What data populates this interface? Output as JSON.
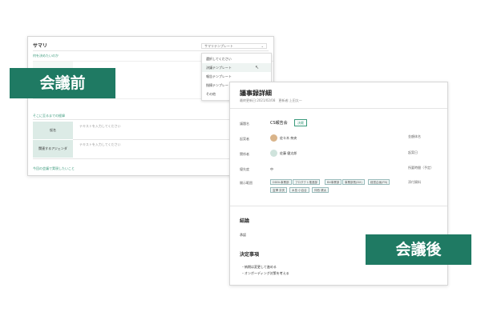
{
  "before": {
    "banner": "会議前",
    "title": "サマリ",
    "template_select": "サマリテンプレート",
    "question1": "何を決めたいのか",
    "dropdown_items": [
      "選択してください",
      "決議テンプレート",
      "報告テンプレート",
      "指摘テンプレート",
      "その他"
    ],
    "section2": "そこに至るまでの経緯",
    "row1_label": "仮名",
    "row2_label": "関連するアジェンダ",
    "placeholder": "テキストを入力してください",
    "question3": "今回の会議で実現したいこと"
  },
  "after": {
    "banner": "会議後",
    "title": "議事録詳細",
    "subtitle": "最終更新日:2021/02/08　更新者:上田太一",
    "fields": {
      "name_label": "議題名",
      "name_value": "CS報告会",
      "status_badge": "決裁",
      "creator_label": "起案者",
      "creator_value": "佐々木 奈央",
      "owner_label": "関係者",
      "owner_value": "佐藤 健太郎",
      "priority_label": "優先度",
      "priority_value": "中",
      "scope_label": "開示範囲"
    },
    "scope_tags": [
      "DDDL事業部",
      "プロダクト推進部",
      "BX事業部",
      "事業部長(DX)",
      "経営企画(FN)",
      "富澤 奈央",
      "木島 小百合",
      "仲西 健太"
    ],
    "right_labels": [
      "金額体名",
      "起案日",
      "所要時間（予定）",
      "添付資料"
    ],
    "conclusion_title": "結論",
    "conclusion_value": "承認",
    "decision_title": "決定事項",
    "decisions": [
      "・納期は変更して進める",
      "・オンボーディング対策を考える"
    ]
  },
  "colors": {
    "brand_green": "#1f7a63",
    "accent_green": "#3a9a7c"
  }
}
